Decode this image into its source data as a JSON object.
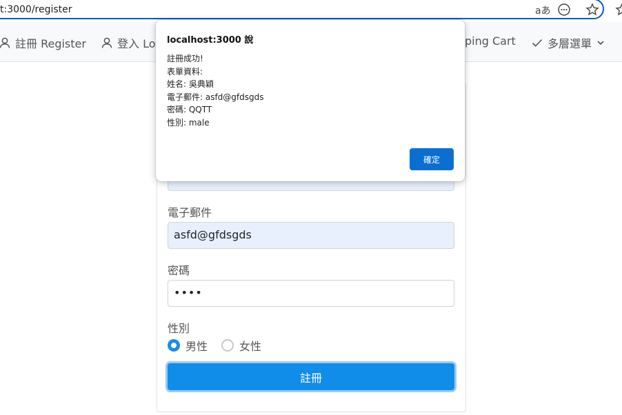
{
  "browser": {
    "url": "t:3000/register",
    "icons": [
      "read-aloud-icon",
      "more-options-icon",
      "favorite-star-icon"
    ]
  },
  "navbar": {
    "items": [
      {
        "label": "註冊 Register",
        "icon": "user-icon"
      },
      {
        "label": "登入 Lo",
        "icon": "user-icon"
      },
      {
        "label": "ping Cart",
        "icon": ""
      },
      {
        "label": "多層選單",
        "icon": "check-icon"
      }
    ]
  },
  "form": {
    "email_label": "電子郵件",
    "email_value": "asfd@gfdsgds",
    "password_label": "密碼",
    "password_value": "••••",
    "gender_label": "性別",
    "gender_options": [
      {
        "label": "男性",
        "checked": true
      },
      {
        "label": "女性",
        "checked": false
      }
    ],
    "submit_label": "註冊"
  },
  "dialog": {
    "title": "localhost:3000 說",
    "lines": [
      "註冊成功!",
      "表單資料:",
      "姓名: 吳典穎",
      "電子郵件: asfd@gfdsgds",
      "密碼: QQTT",
      "性別: male"
    ],
    "ok_label": "確定"
  },
  "colors": {
    "accent": "#108de8",
    "autofill": "#e8f0fe",
    "dialog_button": "#0b6fd1"
  }
}
